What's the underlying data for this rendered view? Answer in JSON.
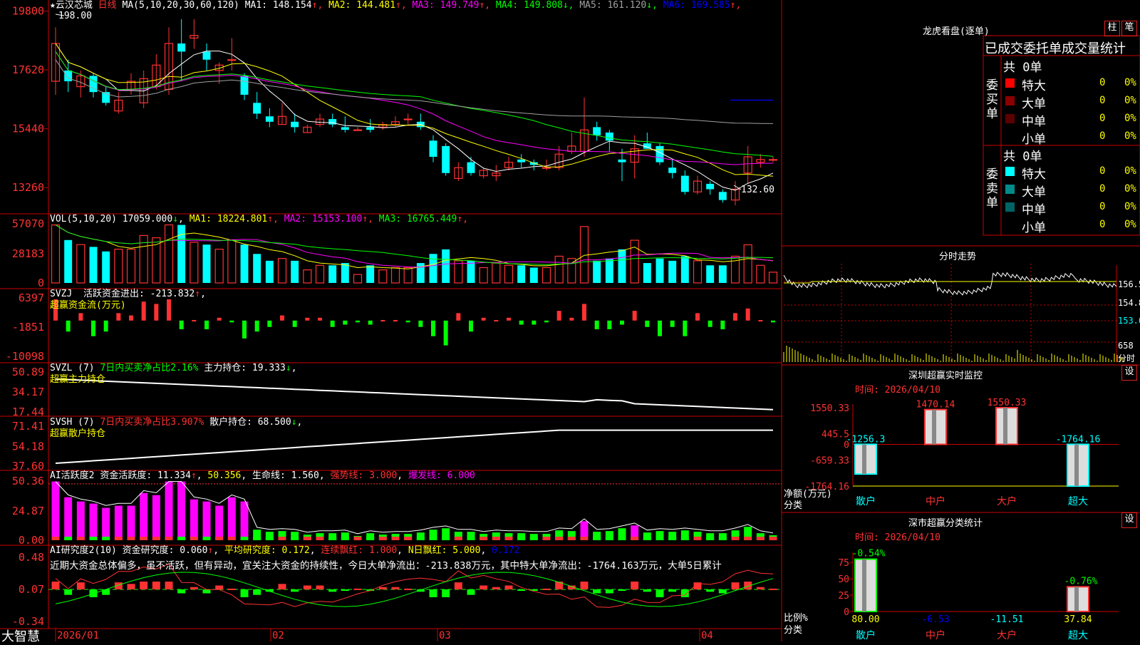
{
  "colors": {
    "up": "#ff3232",
    "down": "#00ffff",
    "grid": "#cc0000",
    "ma1": "#ffffff",
    "ma2": "#ffff00",
    "ma3": "#ff00ff",
    "ma4": "#00ff00",
    "ma5": "#a0a0a0",
    "ma6": "#0000ff",
    "pink": "#ff00ff",
    "green": "#00ff00"
  },
  "kline": {
    "stock_name": "云汉芯城",
    "period": "日线",
    "ma_label": "MA(5,10,20,30,60,120)",
    "ma_values": [
      {
        "label": "MA1:",
        "value": "148.154",
        "arrow": "↑",
        "color": "#ffffff"
      },
      {
        "label": "MA2:",
        "value": "144.481",
        "arrow": "↑",
        "color": "#ffff00"
      },
      {
        "label": "MA3:",
        "value": "149.749",
        "arrow": "↑",
        "color": "#ff00ff"
      },
      {
        "label": "MA4:",
        "value": "149.808",
        "arrow": "↓",
        "color": "#00ff00"
      },
      {
        "label": "MA5:",
        "value": "161.120",
        "arrow": "↓",
        "color": "#a0a0a0"
      },
      {
        "label": "MA6:",
        "value": "169.585",
        "arrow": "↑",
        "color": "#0000ff"
      }
    ],
    "y_ticks": [
      "19800",
      "17620",
      "15440",
      "13260"
    ],
    "high_label": "198.00",
    "low_label": "132.60",
    "candles": [
      [
        172,
        186,
        192,
        167
      ],
      [
        176,
        172,
        180,
        168
      ],
      [
        170,
        174,
        176,
        166
      ],
      [
        174,
        168,
        175,
        166
      ],
      [
        168,
        164,
        170,
        163
      ],
      [
        161,
        165,
        168,
        160
      ],
      [
        169,
        172,
        175,
        167
      ],
      [
        164,
        173,
        176,
        162
      ],
      [
        170,
        178,
        182,
        169
      ],
      [
        169,
        186,
        192,
        167
      ],
      [
        186,
        183,
        195,
        172
      ],
      [
        188,
        189,
        195,
        184
      ],
      [
        183,
        180,
        186,
        176
      ],
      [
        176,
        178,
        179,
        171
      ],
      [
        180,
        180,
        188,
        176
      ],
      [
        174,
        167,
        175,
        165
      ],
      [
        164,
        160,
        168,
        158
      ],
      [
        159,
        157,
        162,
        155
      ],
      [
        156,
        159,
        164,
        156
      ],
      [
        157,
        155,
        160,
        153
      ],
      [
        153,
        155,
        156,
        153
      ],
      [
        156,
        158,
        160,
        155
      ],
      [
        158,
        156,
        160,
        155
      ],
      [
        155,
        154,
        159,
        153
      ],
      [
        154,
        154,
        155,
        154
      ],
      [
        155,
        154,
        158,
        153
      ],
      [
        155,
        156,
        157,
        154
      ],
      [
        156,
        157,
        159,
        155
      ],
      [
        158,
        158,
        160,
        156
      ],
      [
        157,
        155,
        160,
        154
      ],
      [
        150,
        144,
        152,
        142
      ],
      [
        148,
        138,
        149,
        137
      ],
      [
        136,
        140,
        142,
        135
      ],
      [
        142,
        138,
        144,
        137
      ],
      [
        137,
        139,
        140,
        136
      ],
      [
        137,
        138,
        141,
        135
      ],
      [
        140,
        142,
        144,
        139
      ],
      [
        143,
        142,
        145,
        140
      ],
      [
        142,
        141,
        143,
        139
      ],
      [
        140,
        140,
        143,
        139
      ],
      [
        140,
        145,
        148,
        139
      ],
      [
        146,
        148,
        153,
        145
      ],
      [
        146,
        154,
        166,
        144
      ],
      [
        155,
        152,
        157,
        150
      ],
      [
        153,
        150,
        154,
        146
      ],
      [
        143,
        142,
        147,
        135
      ],
      [
        142,
        147,
        152,
        136
      ],
      [
        149,
        147,
        153,
        147
      ],
      [
        148,
        142,
        149,
        141
      ],
      [
        140,
        138,
        143,
        136
      ],
      [
        137,
        131,
        139,
        130
      ],
      [
        131,
        135,
        137,
        130
      ],
      [
        134,
        132,
        135,
        130
      ],
      [
        131,
        128,
        132,
        127
      ],
      [
        128,
        132,
        135,
        126
      ],
      [
        138,
        144,
        148,
        134
      ],
      [
        142,
        143,
        145,
        140
      ],
      [
        143,
        143,
        144,
        142
      ]
    ]
  },
  "vol": {
    "title": "VOL(5,10,20)",
    "value": "17059.000",
    "arrow": "↓",
    "mas": [
      {
        "label": "MA1:",
        "value": "18224.801",
        "arrow": "↑",
        "color": "#ffff00"
      },
      {
        "label": "MA2:",
        "value": "15153.100",
        "arrow": "↑",
        "color": "#ff00ff"
      },
      {
        "label": "MA3:",
        "value": "16765.449",
        "arrow": "↑",
        "color": "#00ff00"
      }
    ],
    "y_ticks": [
      "57070",
      "28183",
      "0"
    ]
  },
  "svzj": {
    "title": "SVZJ",
    "label": "活跃资金进出:",
    "value": "-213.832",
    "arrow": "↑",
    "sub": "超赢资金流(万元)",
    "y_ticks": [
      "6397",
      "-1851",
      "-10098"
    ]
  },
  "svzl": {
    "title": "SVZL (7)",
    "label1": "7日内买卖净占比2.16%",
    "label2": "主力持仓:",
    "value": "19.333",
    "arrow": "↓",
    "sub": "超赢主力持仓",
    "y_ticks": [
      "50.89",
      "34.17",
      "17.44"
    ]
  },
  "svsh": {
    "title": "SVSH (7)",
    "label1": "7日内买卖净占比3.907%",
    "label2": "散户持仓:",
    "value": "68.500",
    "arrow": "↓",
    "sub": "超赢散户持仓",
    "y_ticks": [
      "71.41",
      "54.18",
      "37.60"
    ]
  },
  "ai1": {
    "title": "AI活跃度2",
    "label": "资金活跃度:",
    "v1": "11.334",
    "v2": "50.356",
    "life": "生命线: 1.560",
    "strong": "强势线: 3.000",
    "burst": "爆发线: 6.000",
    "y_ticks": [
      "50.36",
      "24.87",
      "0.00"
    ]
  },
  "ai2": {
    "title": "AI研究度2(10)",
    "label": "资金研究度:",
    "v1": "0.060",
    "avg": "平均研究度: 0.172",
    "cont": "连续飘红: 1.000",
    "nday": "N日飘红: 5.000",
    "v5": "0.172",
    "comment": "近期大资金总体偏多，虽不活跃，但有异动，宜关注大资金的持续性，今日大单净流出：-213.838万元，其中特大单净流出：-1764.163万元，大单5日累计",
    "y_ticks": [
      "0.48",
      "0.07",
      "-0.34"
    ]
  },
  "xaxis": {
    "labels": [
      "2026/01",
      "02",
      "03",
      "04"
    ]
  },
  "brand": "大智慧",
  "longhu": {
    "title": "龙虎看盘(逐单)",
    "btn1": "柱",
    "btn2": "笔",
    "subtitle": "已成交委托单成交量统计",
    "buy_header": "共 0单",
    "buy_label": "委买单",
    "sell_header": "共 0单",
    "sell_label": "委卖单",
    "rows": [
      {
        "name": "特大",
        "count": "0",
        "pct": "0%"
      },
      {
        "name": "大单",
        "count": "0",
        "pct": "0%"
      },
      {
        "name": "中单",
        "count": "0",
        "pct": "0%"
      },
      {
        "name": "小单",
        "count": "0",
        "pct": "0%"
      }
    ],
    "sell_rows": [
      {
        "name": "特大",
        "count": "0",
        "pct": "0%"
      },
      {
        "name": "大单",
        "count": "0",
        "pct": "0%"
      },
      {
        "name": "中单",
        "count": "0",
        "pct": "0%"
      },
      {
        "name": "小单",
        "count": "0",
        "pct": "0%"
      }
    ]
  },
  "fenshi": {
    "title": "分时走势",
    "right_ticks": [
      "156.5",
      "154.8",
      "153.0",
      "658",
      "分时"
    ]
  },
  "szmon": {
    "title": "深圳超赢实时监控",
    "settings": "设",
    "time": "时间: 2026/04/10",
    "y_ticks": [
      "1550.33",
      "445.5",
      "0",
      "-659.33",
      "-1764.16"
    ],
    "ylabel": "净额(万元)",
    "xlabel": "分类",
    "cats": [
      "散户",
      "中户",
      "大户",
      "超大"
    ],
    "values": [
      -1256.3,
      1470.14,
      1550.33,
      -1764.16
    ],
    "value_labels": [
      "-1256.3",
      "1470.14",
      "1550.33",
      "-1764.16"
    ]
  },
  "szcls": {
    "title": "深市超赢分类统计",
    "settings": "设",
    "time": "时间: 2026/04/10",
    "y_ticks": [
      "75",
      "50",
      "25",
      "0"
    ],
    "ylabel": "比例%",
    "xlabel": "分类",
    "cats": [
      "散户",
      "中户",
      "大户",
      "超大"
    ],
    "values": [
      80.0,
      -6.53,
      -11.51,
      37.84
    ],
    "value_labels": [
      "80.00",
      "-6.53",
      "-11.51",
      "37.84"
    ],
    "top_labels": [
      "-0.54%",
      "",
      "",
      "-0.76%"
    ]
  }
}
